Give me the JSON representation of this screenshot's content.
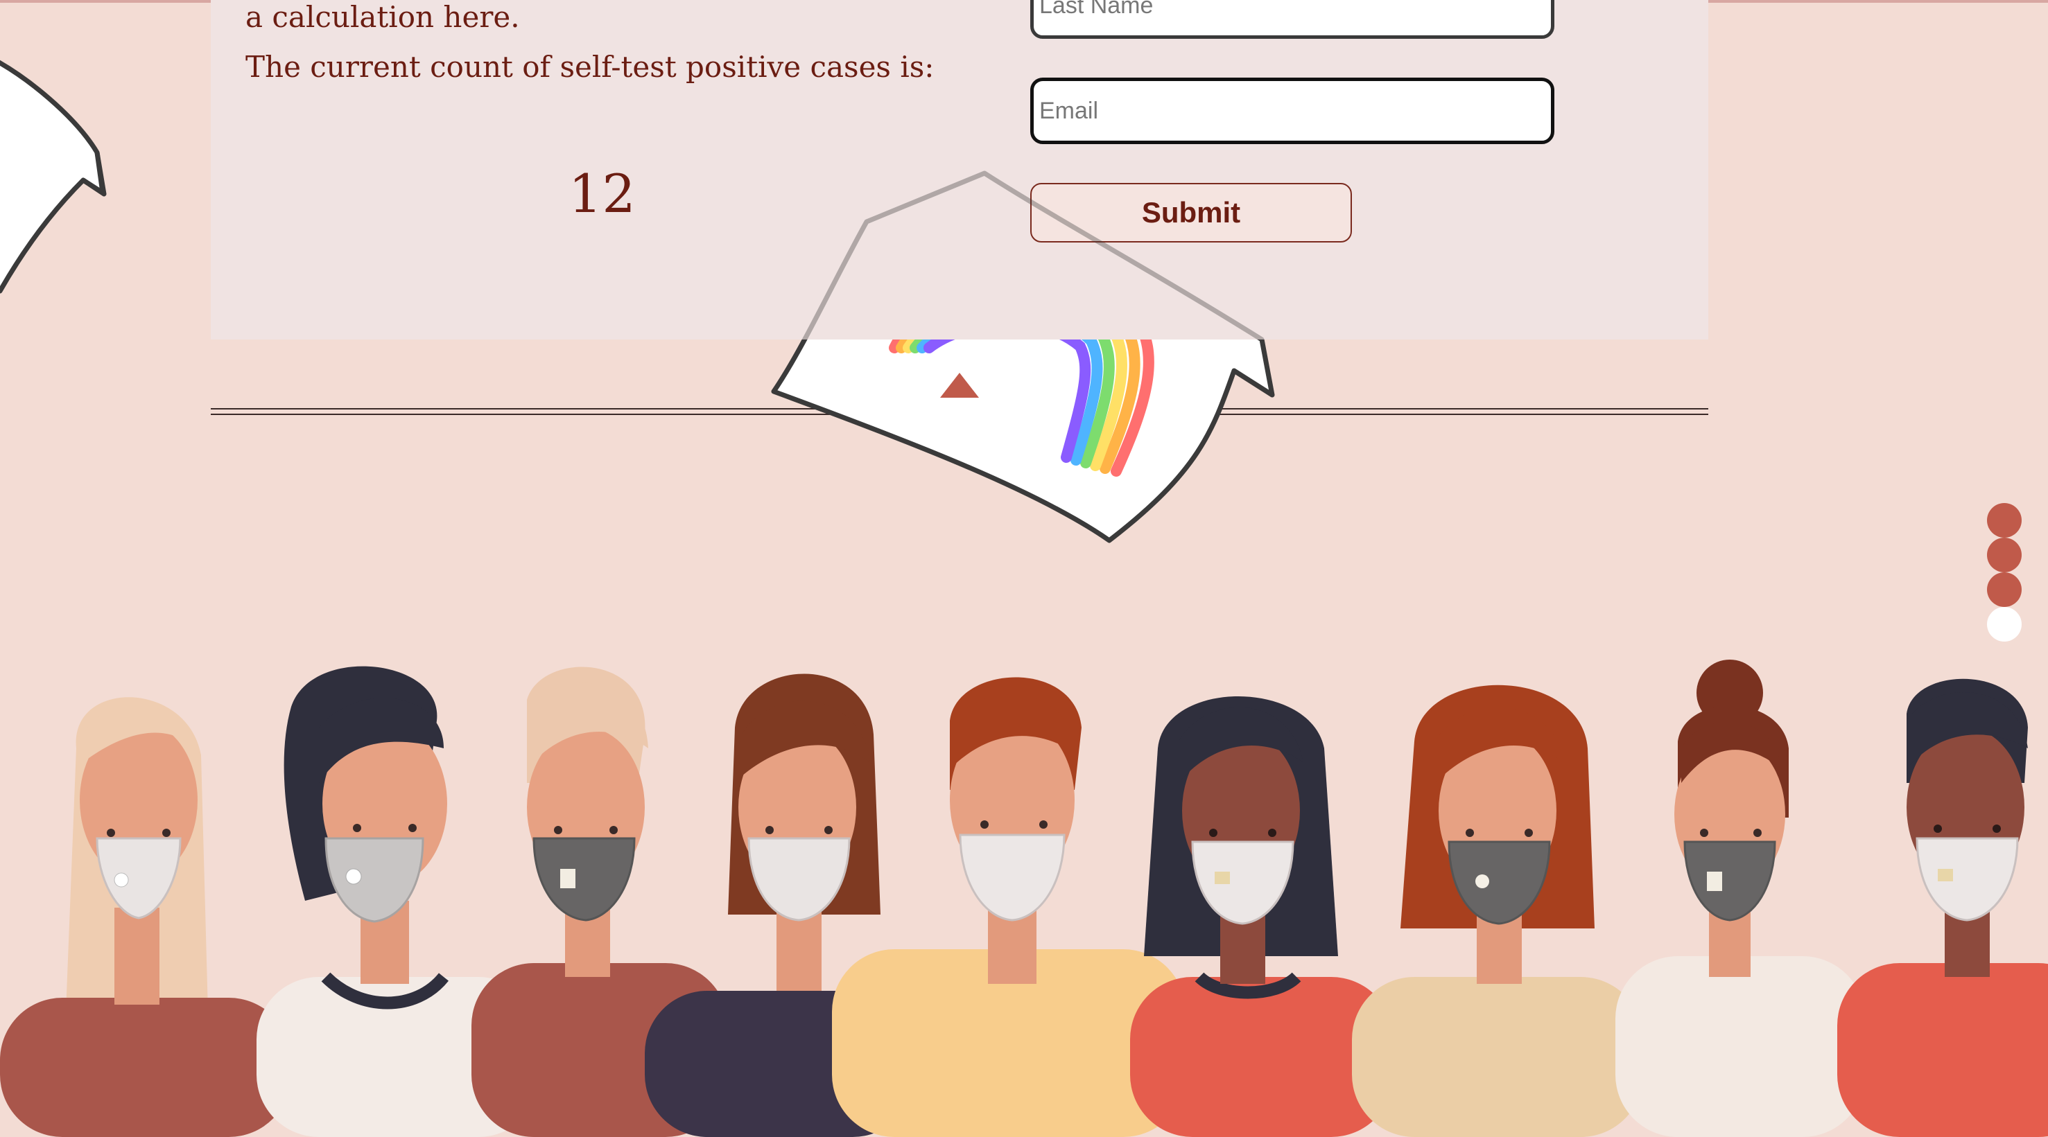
{
  "calculator": {
    "description_tail": "a calculation here.",
    "count_label": "The current count of self-test positive cases is:",
    "count_value": "12"
  },
  "form": {
    "last_name_placeholder": "Last Name",
    "email_placeholder": "Email",
    "submit_label": "Submit"
  },
  "slide_nav": {
    "dots": [
      "slide-1",
      "slide-2",
      "slide-3",
      "slide-4"
    ],
    "active_index": 3
  },
  "colors": {
    "background": "#f3dcd4",
    "panel": "#f0e3e2",
    "text": "#6b1d12",
    "accent": "#c05a4a"
  },
  "icons": {
    "scroll_top": "triangle-up-icon",
    "illustration": "masked-people-illustration",
    "paper": "rainbow-paper-icon"
  }
}
